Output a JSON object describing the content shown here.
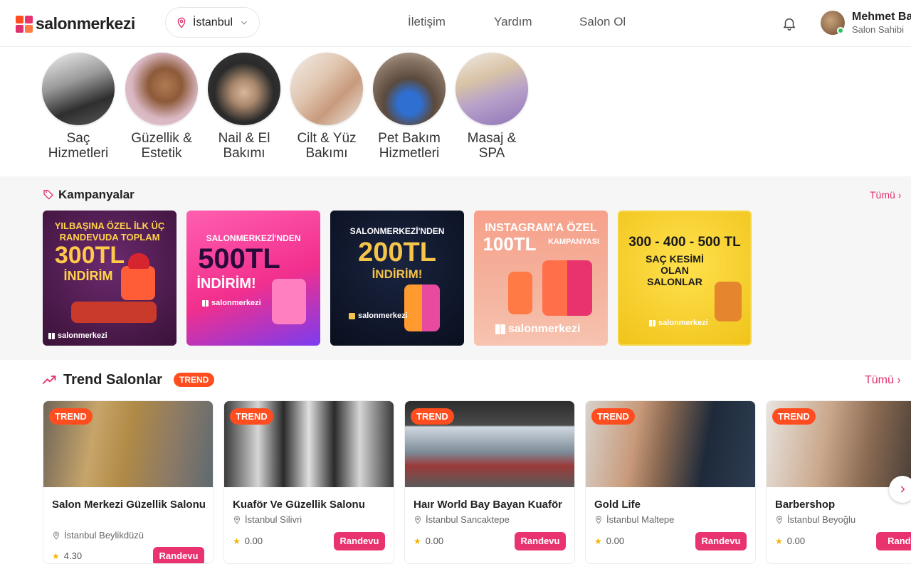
{
  "brand": {
    "name": "salonmerkezi",
    "logo_colors": [
      "#ff4d1f",
      "#e8336f",
      "#ff7a45",
      "#e2306c"
    ]
  },
  "header": {
    "city": "İstanbul",
    "nav": [
      "İletişim",
      "Yardım",
      "Salon Ol"
    ],
    "user_name": "Mehmet Ba",
    "user_role": "Salon Sahibi"
  },
  "categories": [
    {
      "label_1": "Saç",
      "label_2": "Hizmetleri"
    },
    {
      "label_1": "Güzellik &",
      "label_2": "Estetik"
    },
    {
      "label_1": "Nail & El",
      "label_2": "Bakımı"
    },
    {
      "label_1": "Cilt & Yüz",
      "label_2": "Bakımı"
    },
    {
      "label_1": "Pet Bakım",
      "label_2": "Hizmetleri"
    },
    {
      "label_1": "Masaj & SPA",
      "label_2": ""
    }
  ],
  "campaigns": {
    "title": "Kampanyalar",
    "see_all": "Tümü",
    "items": [
      {
        "top": "YILBAŞINA ÖZEL İLK ÜÇ",
        "mid": "RANDEVUDA TOPLAM",
        "big": "300TL",
        "sub": "İNDİRİM",
        "brand": "salonmerkezi"
      },
      {
        "top": "SALONMERKEZİ'NDEN",
        "big": "500TL",
        "sub": "İNDİRİM!",
        "brand": "salonmerkezi"
      },
      {
        "top": "SALONMERKEZİ'NDEN",
        "big": "200TL",
        "sub": "İNDİRİM!",
        "brand": "salonmerkezi"
      },
      {
        "top": "INSTAGRAM'A ÖZEL",
        "big": "100TL",
        "sub": "KAMPANYASI",
        "brand": "salonmerkezi"
      },
      {
        "big": "300 - 400 - 500 TL",
        "mid": "SAÇ KESİMİ",
        "sub": "OLAN",
        "sub2": "SALONLAR",
        "brand": "salonmerkezi"
      }
    ]
  },
  "trend": {
    "title": "Trend Salonlar",
    "badge": "TREND",
    "see_all": "Tümü",
    "cards": [
      {
        "badge": "TREND",
        "name": "Salon Merkezi Güzellik Salonu",
        "location": "İstanbul Beylikdüzü",
        "rating": "4.30",
        "button": "Randevu"
      },
      {
        "badge": "TREND",
        "name": "Kuaför Ve Güzellik Salonu",
        "location": "İstanbul Silivri",
        "rating": "0.00",
        "button": "Randevu"
      },
      {
        "badge": "TREND",
        "name": "Haır World Bay Bayan Kuaför",
        "location": "İstanbul Sancaktepe",
        "rating": "0.00",
        "button": "Randevu"
      },
      {
        "badge": "TREND",
        "name": "Gold Life",
        "location": "İstanbul Maltepe",
        "rating": "0.00",
        "button": "Randevu"
      },
      {
        "badge": "TREND",
        "name": "Barbershop",
        "location": "İstanbul Beyoğlu",
        "rating": "0.00",
        "button": "Rande"
      }
    ]
  }
}
